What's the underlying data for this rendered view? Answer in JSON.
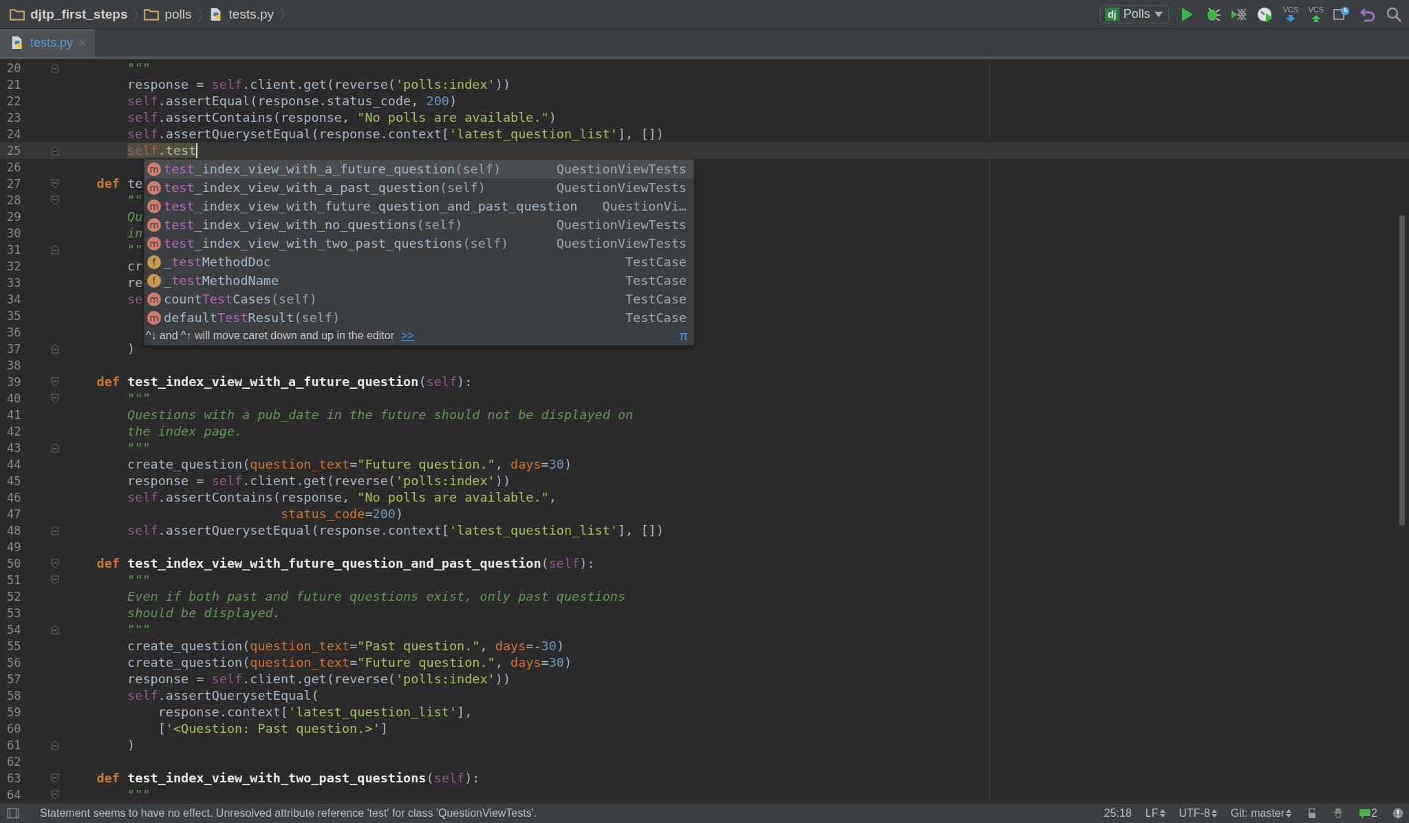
{
  "breadcrumbs": [
    {
      "label": "djtp_first_steps",
      "kind": "folder"
    },
    {
      "label": "polls",
      "kind": "folder"
    },
    {
      "label": "tests.py",
      "kind": "python"
    }
  ],
  "run_config": {
    "badge": "dj",
    "label": "Polls"
  },
  "toolbar": [
    {
      "kind": "run"
    },
    {
      "kind": "debug"
    },
    {
      "kind": "coverage"
    },
    {
      "kind": "profile"
    },
    {
      "kind": "vcs_update",
      "label": "VCS"
    },
    {
      "kind": "vcs_commit",
      "label": "VCS"
    },
    {
      "kind": "history"
    },
    {
      "kind": "revert"
    },
    {
      "kind": "search"
    }
  ],
  "tabs": [
    {
      "label": "tests.py",
      "selected": true
    }
  ],
  "editor": {
    "lines": [
      {
        "n": "20",
        "fold_end": true,
        "tokens": [
          {
            "kind": "doc",
            "text": "        \"\"\""
          }
        ]
      },
      {
        "n": "21",
        "tokens": [
          {
            "kind": "plain",
            "text": "        response = "
          },
          {
            "kind": "self",
            "text": "self"
          },
          {
            "kind": "plain",
            "text": ".client.get(reverse("
          },
          {
            "kind": "string",
            "text": "'polls:index'"
          },
          {
            "kind": "plain",
            "text": "))"
          }
        ]
      },
      {
        "n": "22",
        "tokens": [
          {
            "kind": "self",
            "text": "        self"
          },
          {
            "kind": "plain",
            "text": ".assertEqual(response.status_code, "
          },
          {
            "kind": "number",
            "text": "200"
          },
          {
            "kind": "plain",
            "text": ")"
          }
        ]
      },
      {
        "n": "23",
        "tokens": [
          {
            "kind": "self",
            "text": "        self"
          },
          {
            "kind": "plain",
            "text": ".assertContains(response, "
          },
          {
            "kind": "string",
            "text": "\"No polls are available.\""
          },
          {
            "kind": "plain",
            "text": ")"
          }
        ]
      },
      {
        "n": "24",
        "tokens": [
          {
            "kind": "self",
            "text": "        self"
          },
          {
            "kind": "plain",
            "text": ".assertQuerysetEqual(response.context["
          },
          {
            "kind": "string",
            "text": "'latest_question_list'"
          },
          {
            "kind": "plain",
            "text": "], [])"
          }
        ]
      },
      {
        "n": "25",
        "fold_end": true,
        "current": true,
        "tokens": [
          {
            "kind": "self_warn",
            "text": "        self"
          },
          {
            "kind": "warn",
            "text": ".test"
          }
        ]
      },
      {
        "n": "26"
      },
      {
        "n": "27",
        "fold_start": true,
        "tokens": [
          {
            "kind": "keyword",
            "text": "    def"
          },
          {
            "kind": "plain",
            "text": " te"
          }
        ]
      },
      {
        "n": "28",
        "fold_start": true,
        "tokens": [
          {
            "kind": "doc",
            "text": "        \"\""
          }
        ]
      },
      {
        "n": "29",
        "tokens": [
          {
            "kind": "doc",
            "text": "        Qu"
          }
        ]
      },
      {
        "n": "30",
        "tokens": [
          {
            "kind": "doc",
            "text": "        in"
          }
        ]
      },
      {
        "n": "31",
        "fold_end": true,
        "tokens": [
          {
            "kind": "doc",
            "text": "        \"\""
          }
        ]
      },
      {
        "n": "32",
        "tokens": [
          {
            "kind": "plain",
            "text": "        cr"
          }
        ]
      },
      {
        "n": "33",
        "tokens": [
          {
            "kind": "plain",
            "text": "        re"
          }
        ]
      },
      {
        "n": "34",
        "tokens": [
          {
            "kind": "self",
            "text": "        se"
          }
        ]
      },
      {
        "n": "35"
      },
      {
        "n": "36"
      },
      {
        "n": "37",
        "fold_end": true,
        "tokens": [
          {
            "kind": "plain",
            "text": "        )"
          }
        ]
      },
      {
        "n": "38"
      },
      {
        "n": "39",
        "fold_start": true,
        "tokens": [
          {
            "kind": "keyword",
            "text": "    def"
          },
          {
            "kind": "function",
            "text": " test_index_view_with_a_future_question"
          },
          {
            "kind": "plain",
            "text": "("
          },
          {
            "kind": "self",
            "text": "self"
          },
          {
            "kind": "plain",
            "text": "):"
          }
        ]
      },
      {
        "n": "40",
        "fold_start": true,
        "tokens": [
          {
            "kind": "doc",
            "text": "        \"\"\""
          }
        ]
      },
      {
        "n": "41",
        "tokens": [
          {
            "kind": "doc",
            "text": "        Questions with a pub_date in the future should not be displayed on"
          }
        ]
      },
      {
        "n": "42",
        "tokens": [
          {
            "kind": "doc",
            "text": "        the index page."
          }
        ]
      },
      {
        "n": "43",
        "fold_end": true,
        "tokens": [
          {
            "kind": "doc",
            "text": "        \"\"\""
          }
        ]
      },
      {
        "n": "44",
        "tokens": [
          {
            "kind": "plain",
            "text": "        create_question("
          },
          {
            "kind": "param",
            "text": "question_text"
          },
          {
            "kind": "plain",
            "text": "="
          },
          {
            "kind": "string",
            "text": "\"Future question.\""
          },
          {
            "kind": "plain",
            "text": ", "
          },
          {
            "kind": "param",
            "text": "days"
          },
          {
            "kind": "plain",
            "text": "="
          },
          {
            "kind": "number",
            "text": "30"
          },
          {
            "kind": "plain",
            "text": ")"
          }
        ]
      },
      {
        "n": "45",
        "tokens": [
          {
            "kind": "plain",
            "text": "        response = "
          },
          {
            "kind": "self",
            "text": "self"
          },
          {
            "kind": "plain",
            "text": ".client.get(reverse("
          },
          {
            "kind": "string",
            "text": "'polls:index'"
          },
          {
            "kind": "plain",
            "text": "))"
          }
        ]
      },
      {
        "n": "46",
        "tokens": [
          {
            "kind": "self",
            "text": "        self"
          },
          {
            "kind": "plain",
            "text": ".assertContains(response, "
          },
          {
            "kind": "string",
            "text": "\"No polls are available.\""
          },
          {
            "kind": "plain",
            "text": ","
          }
        ]
      },
      {
        "n": "47",
        "tokens": [
          {
            "kind": "param",
            "text": "                            status_code"
          },
          {
            "kind": "plain",
            "text": "="
          },
          {
            "kind": "number",
            "text": "200"
          },
          {
            "kind": "plain",
            "text": ")"
          }
        ]
      },
      {
        "n": "48",
        "fold_end": true,
        "tokens": [
          {
            "kind": "self",
            "text": "        self"
          },
          {
            "kind": "plain",
            "text": ".assertQuerysetEqual(response.context["
          },
          {
            "kind": "string",
            "text": "'latest_question_list'"
          },
          {
            "kind": "plain",
            "text": "], [])"
          }
        ]
      },
      {
        "n": "49"
      },
      {
        "n": "50",
        "fold_start": true,
        "tokens": [
          {
            "kind": "keyword",
            "text": "    def"
          },
          {
            "kind": "function",
            "text": " test_index_view_with_future_question_and_past_question"
          },
          {
            "kind": "plain",
            "text": "("
          },
          {
            "kind": "self",
            "text": "self"
          },
          {
            "kind": "plain",
            "text": "):"
          }
        ]
      },
      {
        "n": "51",
        "fold_start": true,
        "tokens": [
          {
            "kind": "doc",
            "text": "        \"\"\""
          }
        ]
      },
      {
        "n": "52",
        "tokens": [
          {
            "kind": "doc",
            "text": "        Even if both past and future questions exist, only past questions"
          }
        ]
      },
      {
        "n": "53",
        "tokens": [
          {
            "kind": "doc",
            "text": "        should be displayed."
          }
        ]
      },
      {
        "n": "54",
        "fold_end": true,
        "tokens": [
          {
            "kind": "doc",
            "text": "        \"\"\""
          }
        ]
      },
      {
        "n": "55",
        "tokens": [
          {
            "kind": "plain",
            "text": "        create_question("
          },
          {
            "kind": "param",
            "text": "question_text"
          },
          {
            "kind": "plain",
            "text": "="
          },
          {
            "kind": "string",
            "text": "\"Past question.\""
          },
          {
            "kind": "plain",
            "text": ", "
          },
          {
            "kind": "param",
            "text": "days"
          },
          {
            "kind": "plain",
            "text": "=-"
          },
          {
            "kind": "number",
            "text": "30"
          },
          {
            "kind": "plain",
            "text": ")"
          }
        ]
      },
      {
        "n": "56",
        "tokens": [
          {
            "kind": "plain",
            "text": "        create_question("
          },
          {
            "kind": "param",
            "text": "question_text"
          },
          {
            "kind": "plain",
            "text": "="
          },
          {
            "kind": "string",
            "text": "\"Future question.\""
          },
          {
            "kind": "plain",
            "text": ", "
          },
          {
            "kind": "param",
            "text": "days"
          },
          {
            "kind": "plain",
            "text": "="
          },
          {
            "kind": "number",
            "text": "30"
          },
          {
            "kind": "plain",
            "text": ")"
          }
        ]
      },
      {
        "n": "57",
        "tokens": [
          {
            "kind": "plain",
            "text": "        response = "
          },
          {
            "kind": "self",
            "text": "self"
          },
          {
            "kind": "plain",
            "text": ".client.get(reverse("
          },
          {
            "kind": "string",
            "text": "'polls:index'"
          },
          {
            "kind": "plain",
            "text": "))"
          }
        ]
      },
      {
        "n": "58",
        "tokens": [
          {
            "kind": "self",
            "text": "        self"
          },
          {
            "kind": "plain",
            "text": ".assertQuerysetEqual("
          }
        ]
      },
      {
        "n": "59",
        "tokens": [
          {
            "kind": "plain",
            "text": "            response.context["
          },
          {
            "kind": "string",
            "text": "'latest_question_list'"
          },
          {
            "kind": "plain",
            "text": "],"
          }
        ]
      },
      {
        "n": "60",
        "tokens": [
          {
            "kind": "plain",
            "text": "            ["
          },
          {
            "kind": "string",
            "text": "'<Question: Past question.>'"
          },
          {
            "kind": "plain",
            "text": "]"
          }
        ]
      },
      {
        "n": "61",
        "fold_end": true,
        "tokens": [
          {
            "kind": "plain",
            "text": "        )"
          }
        ]
      },
      {
        "n": "62"
      },
      {
        "n": "63",
        "fold_start": true,
        "tokens": [
          {
            "kind": "keyword",
            "text": "    def"
          },
          {
            "kind": "function",
            "text": " test_index_view_with_two_past_questions"
          },
          {
            "kind": "plain",
            "text": "("
          },
          {
            "kind": "self",
            "text": "self"
          },
          {
            "kind": "plain",
            "text": "):"
          }
        ]
      },
      {
        "n": "64",
        "fold_start": true,
        "tokens": [
          {
            "kind": "doc",
            "text": "        \"\"\""
          }
        ]
      }
    ],
    "completion": {
      "items": [
        {
          "kind": "method",
          "icon": "m",
          "match": "test",
          "rest": "_index_view_with_a_future_question",
          "args": "(self)",
          "type": "QuestionViewTests",
          "selected": true
        },
        {
          "kind": "method",
          "icon": "m",
          "match": "test",
          "rest": "_index_view_with_a_past_question",
          "args": "(self)",
          "type": "QuestionViewTests",
          "selected": false
        },
        {
          "kind": "method",
          "icon": "m",
          "match": "test",
          "rest": "_index_view_with_future_question_and_past_question",
          "type": "QuestionVi…",
          "selected": false
        },
        {
          "kind": "method",
          "icon": "m",
          "match": "test",
          "rest": "_index_view_with_no_questions",
          "args": "(self)",
          "type": "QuestionViewTests",
          "selected": false
        },
        {
          "kind": "method",
          "icon": "m",
          "match": "test",
          "rest": "_index_view_with_two_past_questions",
          "args": "(self)",
          "type": "QuestionViewTests",
          "selected": false
        },
        {
          "kind": "field",
          "icon": "f",
          "before": "_",
          "match": "test",
          "rest": "MethodDoc",
          "type": "TestCase",
          "selected": false
        },
        {
          "kind": "field",
          "icon": "f",
          "before": "_",
          "match": "test",
          "rest": "MethodName",
          "type": "TestCase",
          "selected": false
        },
        {
          "kind": "method",
          "icon": "m",
          "before": "count",
          "match": "Test",
          "rest": "Cases",
          "args": "(self)",
          "type": "TestCase",
          "selected": false
        },
        {
          "kind": "method",
          "icon": "m",
          "before": "default",
          "match": "Test",
          "rest": "Result",
          "args": "(self)",
          "type": "TestCase",
          "selected": false
        }
      ],
      "hint": "^↓ and ^↑ will move caret down and up in the editor",
      "hint_link": ">>",
      "pi": "π"
    }
  },
  "status_bar": {
    "message": "Statement seems to have no effect. Unresolved attribute reference 'test' for class 'QuestionViewTests'.",
    "position": "25:18",
    "line_separator": "LF",
    "encoding": "UTF-8",
    "vcs_branch": "Git: master",
    "event_count": "2"
  }
}
